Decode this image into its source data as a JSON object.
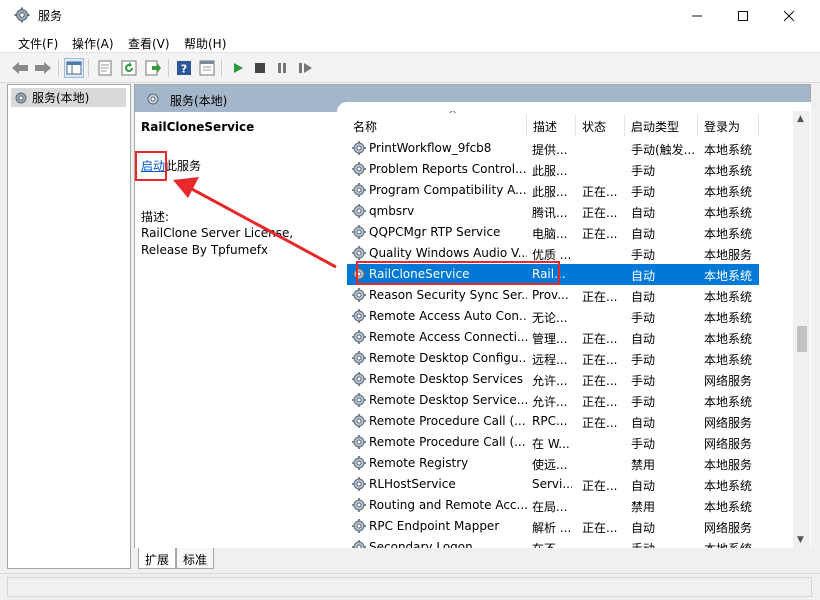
{
  "window": {
    "title": "服务",
    "icon": "gear-icon"
  },
  "menu": [
    {
      "label": "文件(F)"
    },
    {
      "label": "操作(A)"
    },
    {
      "label": "查看(V)"
    },
    {
      "label": "帮助(H)"
    }
  ],
  "tree": {
    "root_label": "服务(本地)"
  },
  "pane_header": {
    "title": "服务(本地)"
  },
  "detail": {
    "service_name": "RailCloneService",
    "action_link": "启动",
    "action_suffix": "此服务",
    "desc_label": "描述:",
    "desc_text": "RailClone Server License, Release By Tpfumefx"
  },
  "columns": {
    "name": "名称",
    "desc": "描述",
    "status": "状态",
    "startup": "启动类型",
    "logon": "登录为"
  },
  "rows": [
    {
      "name": "PrintWorkflow_9fcb8",
      "desc": "提供...",
      "status": "",
      "startup": "手动(触发...",
      "logon": "本地系统"
    },
    {
      "name": "Problem Reports Control...",
      "desc": "此服...",
      "status": "",
      "startup": "手动",
      "logon": "本地系统"
    },
    {
      "name": "Program Compatibility A...",
      "desc": "此服...",
      "status": "正在...",
      "startup": "手动",
      "logon": "本地系统"
    },
    {
      "name": "qmbsrv",
      "desc": "腾讯...",
      "status": "正在...",
      "startup": "自动",
      "logon": "本地系统"
    },
    {
      "name": "QQPCMgr RTP Service",
      "desc": "电脑...",
      "status": "正在...",
      "startup": "自动",
      "logon": "本地系统"
    },
    {
      "name": "Quality Windows Audio V...",
      "desc": "优质 ...",
      "status": "",
      "startup": "手动",
      "logon": "本地服务"
    },
    {
      "name": "RailCloneService",
      "desc": "Rail...",
      "status": "",
      "startup": "自动",
      "logon": "本地系统",
      "selected": true
    },
    {
      "name": "Reason Security Sync Ser...",
      "desc": "Prov...",
      "status": "正在...",
      "startup": "自动",
      "logon": "本地系统"
    },
    {
      "name": "Remote Access Auto Con...",
      "desc": "无论...",
      "status": "",
      "startup": "手动",
      "logon": "本地系统"
    },
    {
      "name": "Remote Access Connecti...",
      "desc": "管理...",
      "status": "正在...",
      "startup": "自动",
      "logon": "本地系统"
    },
    {
      "name": "Remote Desktop Configu...",
      "desc": "远程...",
      "status": "正在...",
      "startup": "手动",
      "logon": "本地系统"
    },
    {
      "name": "Remote Desktop Services",
      "desc": "允许...",
      "status": "正在...",
      "startup": "手动",
      "logon": "网络服务"
    },
    {
      "name": "Remote Desktop Service...",
      "desc": "允许...",
      "status": "正在...",
      "startup": "手动",
      "logon": "本地系统"
    },
    {
      "name": "Remote Procedure Call (...",
      "desc": "RPC...",
      "status": "正在...",
      "startup": "自动",
      "logon": "网络服务"
    },
    {
      "name": "Remote Procedure Call (...",
      "desc": "在 W...",
      "status": "",
      "startup": "手动",
      "logon": "网络服务"
    },
    {
      "name": "Remote Registry",
      "desc": "使远...",
      "status": "",
      "startup": "禁用",
      "logon": "本地服务"
    },
    {
      "name": "RLHostService",
      "desc": "Servi...",
      "status": "正在...",
      "startup": "自动",
      "logon": "本地系统"
    },
    {
      "name": "Routing and Remote Acc...",
      "desc": "在局...",
      "status": "",
      "startup": "禁用",
      "logon": "本地系统"
    },
    {
      "name": "RPC Endpoint Mapper",
      "desc": "解析 ...",
      "status": "正在...",
      "startup": "自动",
      "logon": "网络服务"
    },
    {
      "name": "Secondary Logon",
      "desc": "在不...",
      "status": "",
      "startup": "手动",
      "logon": "本地系统"
    }
  ],
  "tabs": [
    {
      "label": "扩展"
    },
    {
      "label": "标准"
    }
  ],
  "colors": {
    "selection": "#0078d7",
    "header_band": "#a4b6c9",
    "annotation": "#e8292c",
    "link": "#0055cc"
  }
}
